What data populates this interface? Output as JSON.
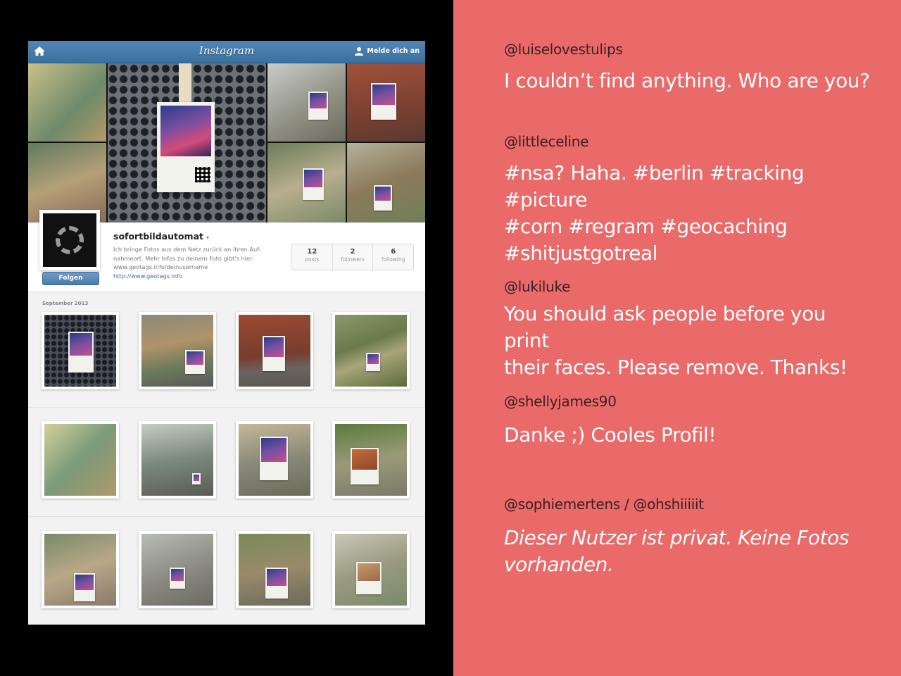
{
  "instagram": {
    "logo": "Instagram",
    "login_label": "Melde dich an",
    "profile": {
      "username": "sofortbildautomat",
      "caret": "▾",
      "bio_line1": "Ich bringe Fotos aus dem Netz zurück an ihren Auf-",
      "bio_line2": "nahmeort. Mehr Infos zu deinem Foto gibt's hier:",
      "bio_line3": "www.geotags.info/deinusername",
      "link": "http://www.geotags.info",
      "follow_label": "Folgen",
      "stats": [
        {
          "number": "12",
          "label": "posts"
        },
        {
          "number": "2",
          "label": "followers"
        },
        {
          "number": "6",
          "label": "following"
        }
      ]
    },
    "grid_month": "September 2013",
    "colors": {
      "topbar": "#3b6f9e",
      "follow_button": "#4b7bab",
      "link": "#3a6a9a"
    }
  },
  "comments": [
    {
      "handle": "@luiselovestulips",
      "text": "I couldn’t find anything. Who are you?"
    },
    {
      "handle": "@littleceline",
      "line1": "#nsa? Haha. #berlin #tracking #picture",
      "line2": "#corn #regram #geocaching",
      "line3": "#shitjustgotreal"
    },
    {
      "handle": "@lukiluke",
      "line1": "You should ask people before you print",
      "line2": "their faces. Please remove. Thanks!"
    },
    {
      "handle": "@shellyjames90",
      "text": "Danke ;) Cooles Profil!"
    },
    {
      "handle": "@sophiemertens / @ohshiiiiit",
      "line1": "Dieser Nutzer ist privat. Keine Fotos",
      "line2": "vorhanden."
    }
  ],
  "icons": [
    "home-icon",
    "user-icon"
  ],
  "background_color": "#e96a69"
}
